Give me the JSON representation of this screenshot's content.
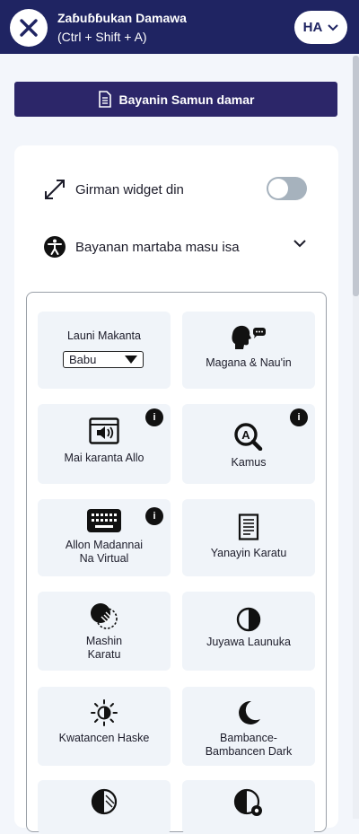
{
  "header": {
    "title": "Zaɓuɓɓukan Damawa",
    "shortcut": "(Ctrl + Shift + A)",
    "language": "HA"
  },
  "statement_button": {
    "label": "Bayanin Samun damar"
  },
  "rows": {
    "widget_size_label": "Girman widget din",
    "profiles_label": "Bayanan martaba masu isa"
  },
  "tiles": [
    {
      "label": "Launi Makanta",
      "select_value": "Babu"
    },
    {
      "label": "Magana & Nau'in"
    },
    {
      "label": "Mai karanta Allo",
      "badge": "i"
    },
    {
      "label": "Kamus",
      "badge": "i"
    },
    {
      "label_line1": "Allon Madannai",
      "label_line2": "Na Virtual",
      "badge": "i"
    },
    {
      "label": "Yanayin Karatu"
    },
    {
      "label_line1": "Mashin",
      "label_line2": "Karatu"
    },
    {
      "label": "Juyawa Launuka"
    },
    {
      "label": "Kwatancen Haske"
    },
    {
      "label_line1": "Bambance-",
      "label_line2": "Bambancen Dark"
    }
  ],
  "icons": [
    "close-icon",
    "chevron-down-icon",
    "document-icon",
    "resize-arrows-icon",
    "accessibility-person-icon",
    "speaking-head-icon",
    "screen-reader-icon",
    "dictionary-icon",
    "keyboard-icon",
    "reading-mode-icon",
    "reading-mask-icon",
    "invert-colors-icon",
    "light-contrast-icon",
    "dark-contrast-icon",
    "half-circle-icon",
    "contrast-settings-icon"
  ],
  "colors": {
    "header_bg": "#1f2462",
    "button_bg": "#2c2669",
    "tile_bg": "#f0f4f9",
    "toggle_off": "#a6b2bd"
  }
}
